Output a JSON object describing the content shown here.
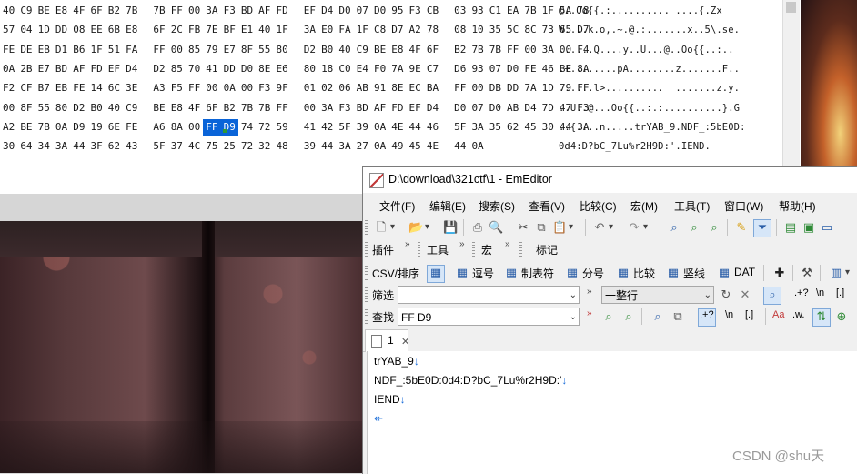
{
  "hex_view": {
    "rows": [
      {
        "bytes": [
          "40",
          "C9",
          "BE",
          "E8",
          "4F",
          "6F",
          "B2",
          "7B",
          "7B",
          "FF",
          "00",
          "3A",
          "F3",
          "BD",
          "AF",
          "FD",
          "EF",
          "D4",
          "D0",
          "07",
          "D0",
          "95",
          "F3",
          "CB",
          "03",
          "93",
          "C1",
          "EA",
          "7B",
          "1F",
          "5A",
          "78"
        ],
        "ascii": "@..Oo{{.:.......... ....{.Zx"
      },
      {
        "bytes": [
          "57",
          "04",
          "1D",
          "DD",
          "08",
          "EE",
          "6B",
          "E8",
          "6F",
          "2C",
          "FB",
          "7E",
          "BF",
          "E1",
          "40",
          "1F",
          "3A",
          "E0",
          "FA",
          "1F",
          "C8",
          "D7",
          "A2",
          "78",
          "08",
          "10",
          "35",
          "5C",
          "8C",
          "73",
          "65",
          "D7"
        ],
        "ascii": "W....k.o,.~.@.:.......x..5\\.se."
      },
      {
        "bytes": [
          "FE",
          "DE",
          "EB",
          "D1",
          "B6",
          "1F",
          "51",
          "FA",
          "FF",
          "00",
          "85",
          "79",
          "E7",
          "8F",
          "55",
          "80",
          "D2",
          "B0",
          "40",
          "C9",
          "BE",
          "E8",
          "4F",
          "6F",
          "B2",
          "7B",
          "7B",
          "FF",
          "00",
          "3A",
          "00",
          "F4"
        ],
        "ascii": "......Q....y..U...@..Oo{{..:.."
      },
      {
        "bytes": [
          "0A",
          "2B",
          "E7",
          "BD",
          "AF",
          "FD",
          "EF",
          "D4",
          "D2",
          "85",
          "70",
          "41",
          "DD",
          "D0",
          "8E",
          "E6",
          "80",
          "18",
          "C0",
          "E4",
          "F0",
          "7A",
          "9E",
          "C7",
          "D6",
          "93",
          "07",
          "D0",
          "FE",
          "46",
          "BE",
          "8A"
        ],
        "ascii": ".+........pA........z.......F.."
      },
      {
        "bytes": [
          "F2",
          "CF",
          "B7",
          "EB",
          "FE",
          "14",
          "6C",
          "3E",
          "A3",
          "F5",
          "FF",
          "00",
          "0A",
          "00",
          "F3",
          "9F",
          "01",
          "02",
          "06",
          "AB",
          "91",
          "8E",
          "EC",
          "BA",
          "FF",
          "00",
          "DB",
          "DD",
          "7A",
          "1D",
          "79",
          "FF"
        ],
        "ascii": "......l>..........  .......z.y."
      },
      {
        "bytes": [
          "00",
          "8F",
          "55",
          "80",
          "D2",
          "B0",
          "40",
          "C9",
          "BE",
          "E8",
          "4F",
          "6F",
          "B2",
          "7B",
          "7B",
          "FF",
          "00",
          "3A",
          "F3",
          "BD",
          "AF",
          "FD",
          "EF",
          "D4",
          "D0",
          "07",
          "D0",
          "AB",
          "D4",
          "7D",
          "47",
          "F3"
        ],
        "ascii": "..U..@...Oo{{..:.:..........}.G"
      },
      {
        "bytes": [
          "A2",
          "BE",
          "7B",
          "0A",
          "D9",
          "19",
          "6E",
          "FE",
          "A6",
          "8A",
          "00",
          "FF",
          "D9",
          "74",
          "72",
          "59",
          "41",
          "42",
          "5F",
          "39",
          "0A",
          "4E",
          "44",
          "46",
          "5F",
          "3A",
          "35",
          "62",
          "45",
          "30",
          "44",
          "3A"
        ],
        "ascii": "..{....n.....trYAB_9.NDF_:5bE0D:",
        "selected": [
          11,
          12
        ]
      },
      {
        "bytes": [
          "30",
          "64",
          "34",
          "3A",
          "44",
          "3F",
          "62",
          "43",
          "5F",
          "37",
          "4C",
          "75",
          "25",
          "72",
          "32",
          "48",
          "39",
          "44",
          "3A",
          "27",
          "0A",
          "49",
          "45",
          "4E",
          "44",
          "0A"
        ],
        "ascii": "0d4:D?bC_7Lu%r2H9D:'.IEND."
      }
    ]
  },
  "editor_window": {
    "title": "D:\\download\\321ctf\\1 - EmEditor",
    "menu": [
      "文件(F)",
      "编辑(E)",
      "搜索(S)",
      "查看(V)",
      "比较(C)",
      "宏(M)",
      "工具(T)",
      "窗口(W)",
      "帮助(H)"
    ],
    "toolbar2": {
      "plugins": "插件",
      "tools": "工具",
      "macro": "宏",
      "marks": "标记"
    },
    "toolbar3": {
      "csv": "CSV/排序",
      "comma": "逗号",
      "tab": "制表符",
      "semicolon": "分号",
      "compare": "比较",
      "pipe": "竖线",
      "dat": "DAT"
    },
    "filter": {
      "label": "筛选",
      "value": "",
      "mode": "一整行"
    },
    "find": {
      "label": "查找",
      "value": "FF D9"
    },
    "tab_label": "1",
    "lines": [
      "trYAB_9",
      "NDF_:5bE0D:0d4:D?bC_7Lu%r2H9D:'",
      "IEND",
      ""
    ]
  },
  "watermark": "CSDN @shu天",
  "colors": {
    "selection": "#0a64d8",
    "newline_mark": "#1e6fd9",
    "accent": "#2e9a36"
  }
}
